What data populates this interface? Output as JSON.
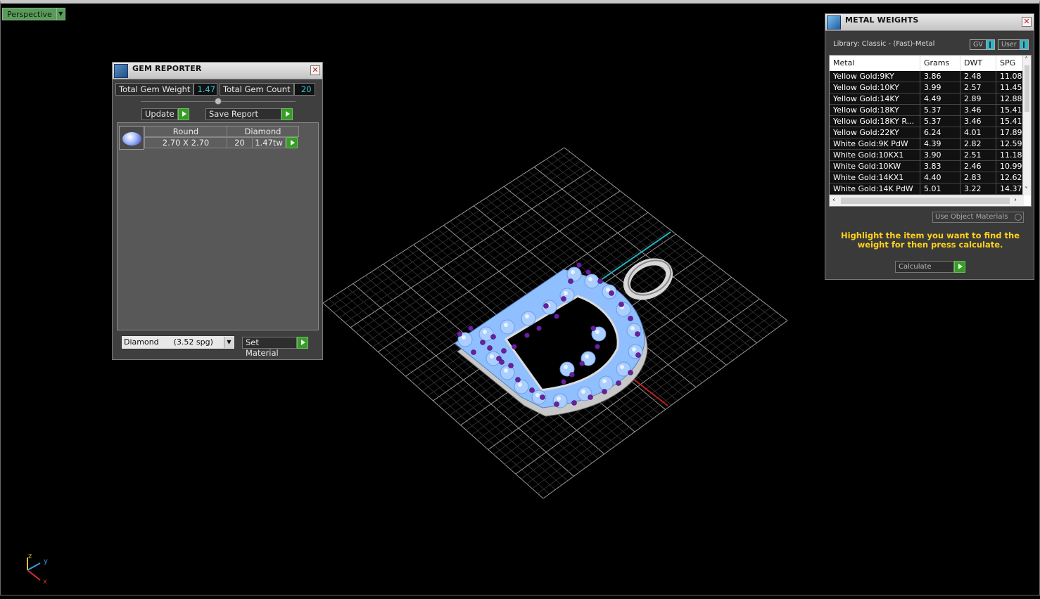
{
  "viewport": {
    "view_label": "Perspective"
  },
  "gem_reporter": {
    "title": "GEM REPORTER",
    "total_gem_weight_label": "Total Gem Weight",
    "total_gem_weight": "1.47",
    "total_gem_count_label": "Total Gem Count",
    "total_gem_count": "20",
    "update_label": "Update",
    "save_report_label": "Save Report",
    "gem": {
      "shape": "Round",
      "material": "Diamond",
      "size": "2.70 X 2.70",
      "count": "20",
      "weight": "1.47tw"
    },
    "material_select_value": "Diamond      (3.52 spg)",
    "set_material_label": "Set Material"
  },
  "metal_weights": {
    "title": "METAL WEIGHTS",
    "library": "Library: Classic - (Fast)-Metal",
    "toggle_gv": "GV",
    "toggle_user": "User",
    "columns": [
      "Metal",
      "Grams",
      "DWT",
      "SPG"
    ],
    "rows": [
      [
        "Yellow Gold:9KY",
        "3.86",
        "2.48",
        "11.08"
      ],
      [
        "Yellow Gold:10KY",
        "3.99",
        "2.57",
        "11.45"
      ],
      [
        "Yellow Gold:14KY",
        "4.49",
        "2.89",
        "12.88"
      ],
      [
        "Yellow Gold:18KY",
        "5.37",
        "3.46",
        "15.41"
      ],
      [
        "Yellow Gold:18KY R...",
        "5.37",
        "3.46",
        "15.41"
      ],
      [
        "Yellow Gold:22KY",
        "6.24",
        "4.01",
        "17.89"
      ],
      [
        "White Gold:9K PdW",
        "4.39",
        "2.82",
        "12.59"
      ],
      [
        "White Gold:10KX1",
        "3.90",
        "2.51",
        "11.18"
      ],
      [
        "White Gold:10KW",
        "3.83",
        "2.46",
        "10.99"
      ],
      [
        "White Gold:14KX1",
        "4.40",
        "2.83",
        "12.62"
      ],
      [
        "White Gold:14K PdW",
        "5.01",
        "3.22",
        "14.37"
      ]
    ],
    "use_object_materials": "Use Object Materials",
    "hint": "Highlight the item you want to find the weight for then press calculate.",
    "calculate_label": "Calculate"
  },
  "axis": {
    "z": "z",
    "y": "y",
    "x": "x"
  },
  "colors": {
    "accent_green": "#3a9a2a",
    "value_cyan": "#39c6d6",
    "hint_yellow": "#ffd21a",
    "gem_blue": "#8fbfff",
    "prong_purple": "#6a1fa0"
  }
}
